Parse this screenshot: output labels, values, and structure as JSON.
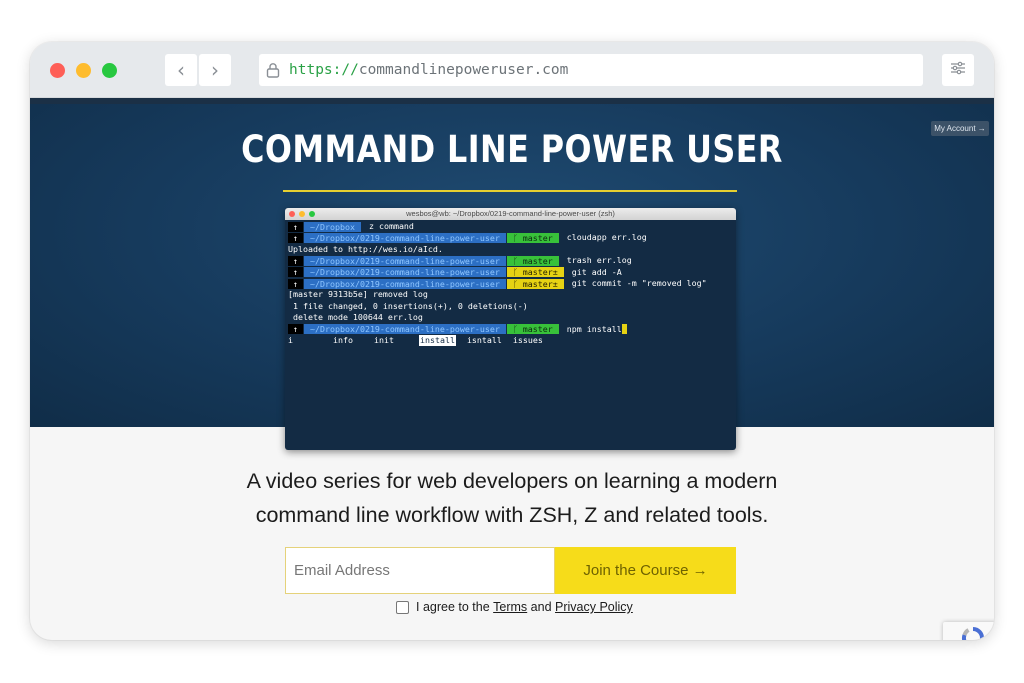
{
  "browser": {
    "url_scheme": "https://",
    "url_host": "commandlinepoweruser.com",
    "icons": [
      "back-icon",
      "forward-icon",
      "lock-icon",
      "settings-sliders-icon"
    ]
  },
  "header": {
    "account_button": "My Account →",
    "title": "COMMAND LINE POWER USER"
  },
  "terminal": {
    "window_title": "wesbos@wb: ~/Dropbox/0219-command-line-power-user (zsh)",
    "arrow": "↑",
    "lines": {
      "l1": {
        "path": "~/Dropbox",
        "command": "z command"
      },
      "l2": {
        "path": "~/Dropbox/0219-command-line-power-user",
        "branch": "ᚴ master",
        "command": "cloudapp err.log"
      },
      "l3": {
        "text": "Uploaded to http://wes.io/aIcd."
      },
      "l4": {
        "path": "~/Dropbox/0219-command-line-power-user",
        "branch": "ᚴ master",
        "command": "trash err.log"
      },
      "l5": {
        "path": "~/Dropbox/0219-command-line-power-user",
        "branch": "ᚴ master±",
        "command": "git add -A"
      },
      "l6": {
        "path": "~/Dropbox/0219-command-line-power-user",
        "branch": "ᚴ master±",
        "command": "git commit -m \"removed log\""
      },
      "l7": {
        "text": "[master 9313b5e] removed log"
      },
      "l8": {
        "text": " 1 file changed, 0 insertions(+), 0 deletions(-)"
      },
      "l9": {
        "text": " delete mode 100644 err.log"
      },
      "l10": {
        "path": "~/Dropbox/0219-command-line-power-user",
        "branch": "ᚴ master",
        "command": "npm install"
      },
      "completions": {
        "c1": "i",
        "c2": "info",
        "c3": "init",
        "c4": "install",
        "c5": "isntall",
        "c6": "issues"
      }
    }
  },
  "tagline": {
    "line1": "A video series for web developers on learning a modern",
    "line2": "command line workflow with ZSH, Z and related tools."
  },
  "signup": {
    "email_placeholder": "Email Address",
    "join_button": "Join the Course →",
    "agree_prefix": "I agree to the",
    "terms_link": "Terms",
    "and_text": "and",
    "privacy_link": "Privacy Policy"
  },
  "colors": {
    "hero_bg": "#163a5c",
    "accent_yellow": "#f6dc1a",
    "title_rule": "#e6cf30",
    "url_scheme": "#2aa146"
  }
}
